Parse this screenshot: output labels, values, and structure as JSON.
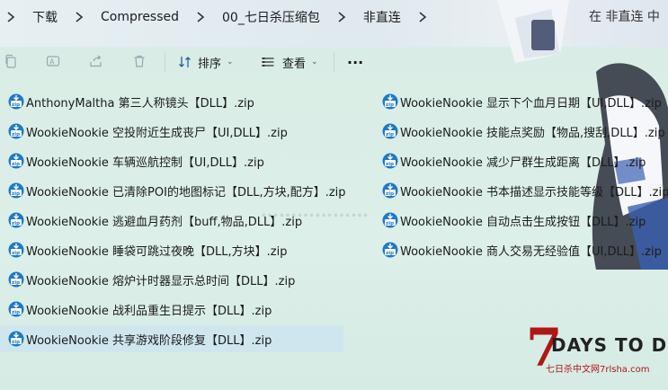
{
  "breadcrumb": {
    "items": [
      "下载",
      "Compressed",
      "00_七日杀压缩包",
      "非直连"
    ],
    "search_hint": "在 非直连 中"
  },
  "toolbar": {
    "sort_label": "排序",
    "view_label": "查看",
    "more_label": "···"
  },
  "files": [
    {
      "name": "AnthonyMaltha 第三人称镜头【DLL】.zip",
      "selected": false
    },
    {
      "name": "WookieNookie 空投附近生成丧尸【UI,DLL】.zip",
      "selected": false
    },
    {
      "name": "WookieNookie 车辆巡航控制【UI,DLL】.zip",
      "selected": false
    },
    {
      "name": "WookieNookie 已清除POI的地图标记【DLL,方块,配方】.zip",
      "selected": false
    },
    {
      "name": "WookieNookie 逃避血月药剂【buff,物品,DLL】.zip",
      "selected": false
    },
    {
      "name": "WookieNookie 睡袋可跳过夜晚【DLL,方块】.zip",
      "selected": false
    },
    {
      "name": "WookieNookie 熔炉计时器显示总时间【DLL】.zip",
      "selected": false
    },
    {
      "name": "WookieNookie 战利品重生日提示【DLL】.zip",
      "selected": false
    },
    {
      "name": "WookieNookie 共享游戏阶段修复【DLL】.zip",
      "selected": true
    },
    {
      "name": "WookieNookie 显示下个血月日期【UI,DLL】.zip",
      "selected": false
    },
    {
      "name": "WookieNookie 技能点奖励【物品,搜刮,DLL】.zip",
      "selected": false
    },
    {
      "name": "WookieNookie 减少尸群生成距离【DLL】.zip",
      "selected": false
    },
    {
      "name": "WookieNookie 书本描述显示技能等级【DLL】.zip",
      "selected": false
    },
    {
      "name": "WookieNookie 自动点击生成按钮【DLL】.zip",
      "selected": false
    },
    {
      "name": "WookieNookie 商人交易无经验值【UI,DLL】.zip",
      "selected": false
    }
  ],
  "wallpaper": {
    "logo_text": "DAYS TO DIE",
    "logo_numeral": "7",
    "logo_site": "七日杀中文网7rlsha.com"
  },
  "colors": {
    "background": "#ddeee9",
    "selection": "#cfe6ee",
    "zip_icon": "#1f78c8",
    "logo_red": "#b01616"
  }
}
